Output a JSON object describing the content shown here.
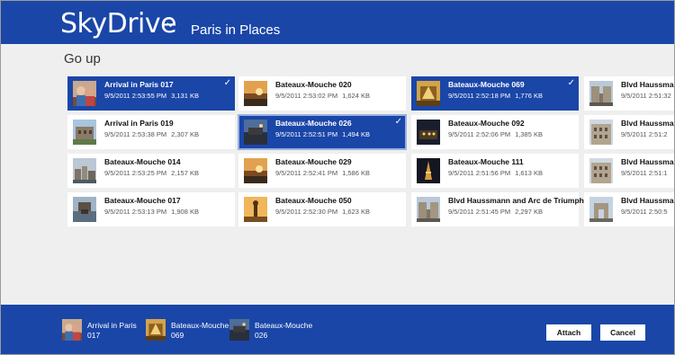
{
  "header": {
    "app_title": "SkyDrive",
    "folder_name": "Paris in Places"
  },
  "nav": {
    "go_up": "Go up"
  },
  "files": [
    {
      "name": "Arrival in Paris 017",
      "date": "9/5/2011 2:53:55 PM",
      "size": "3,131 KB",
      "selected": true,
      "thumb": "people"
    },
    {
      "name": "Arrival in Paris 019",
      "date": "9/5/2011 2:53:38 PM",
      "size": "2,307 KB",
      "selected": false,
      "thumb": "building"
    },
    {
      "name": "Bateaux-Mouche 014",
      "date": "9/5/2011 2:53:25 PM",
      "size": "2,157 KB",
      "selected": false,
      "thumb": "city"
    },
    {
      "name": "Bateaux-Mouche 017",
      "date": "9/5/2011 2:53:13 PM",
      "size": "1,908 KB",
      "selected": false,
      "thumb": "river"
    },
    {
      "name": "Bateaux-Mouche 020",
      "date": "9/5/2011 2:53:02 PM",
      "size": "1,624 KB",
      "selected": false,
      "thumb": "sunset"
    },
    {
      "name": "Bateaux-Mouche 026",
      "date": "9/5/2011 2:52:51 PM",
      "size": "1,494 KB",
      "selected": true,
      "thumb": "dusk"
    },
    {
      "name": "Bateaux-Mouche 029",
      "date": "9/5/2011 2:52:41 PM",
      "size": "1,586 KB",
      "selected": false,
      "thumb": "sunset"
    },
    {
      "name": "Bateaux-Mouche 050",
      "date": "9/5/2011 2:52:30 PM",
      "size": "1,623 KB",
      "selected": false,
      "thumb": "statue"
    },
    {
      "name": "Bateaux-Mouche 069",
      "date": "9/5/2011 2:52:18 PM",
      "size": "1,776 KB",
      "selected": true,
      "thumb": "gold"
    },
    {
      "name": "Bateaux-Mouche 092",
      "date": "9/5/2011 2:52:06 PM",
      "size": "1,385 KB",
      "selected": false,
      "thumb": "night"
    },
    {
      "name": "Bateaux-Mouche 111",
      "date": "9/5/2011 2:51:56 PM",
      "size": "1,613 KB",
      "selected": false,
      "thumb": "tower"
    },
    {
      "name": "Blvd Haussmann and Arc de Triumph",
      "date": "9/5/2011 2:51:45 PM",
      "size": "2,297 KB",
      "selected": false,
      "thumb": "street"
    },
    {
      "name": "Blvd Haussmann",
      "date": "9/5/2011 2:51:32",
      "size": "",
      "selected": false,
      "thumb": "street"
    },
    {
      "name": "Blvd Haussmann",
      "date": "9/5/2011 2:51:2",
      "size": "",
      "selected": false,
      "thumb": "facade"
    },
    {
      "name": "Blvd Haussmann",
      "date": "9/5/2011 2:51:1",
      "size": "",
      "selected": false,
      "thumb": "facade"
    },
    {
      "name": "Blvd Haussmann",
      "date": "9/5/2011 2:50:5",
      "size": "",
      "selected": false,
      "thumb": "arc"
    }
  ],
  "selection_tray": [
    {
      "label": "Arrival in Paris 017",
      "thumb": "people"
    },
    {
      "label": "Bateaux-Mouche 069",
      "thumb": "gold"
    },
    {
      "label": "Bateaux-Mouche 026",
      "thumb": "dusk"
    }
  ],
  "actions": {
    "attach_label": "Attach",
    "cancel_label": "Cancel"
  },
  "colors": {
    "accent": "#1a46a8",
    "background": "#efefef"
  }
}
